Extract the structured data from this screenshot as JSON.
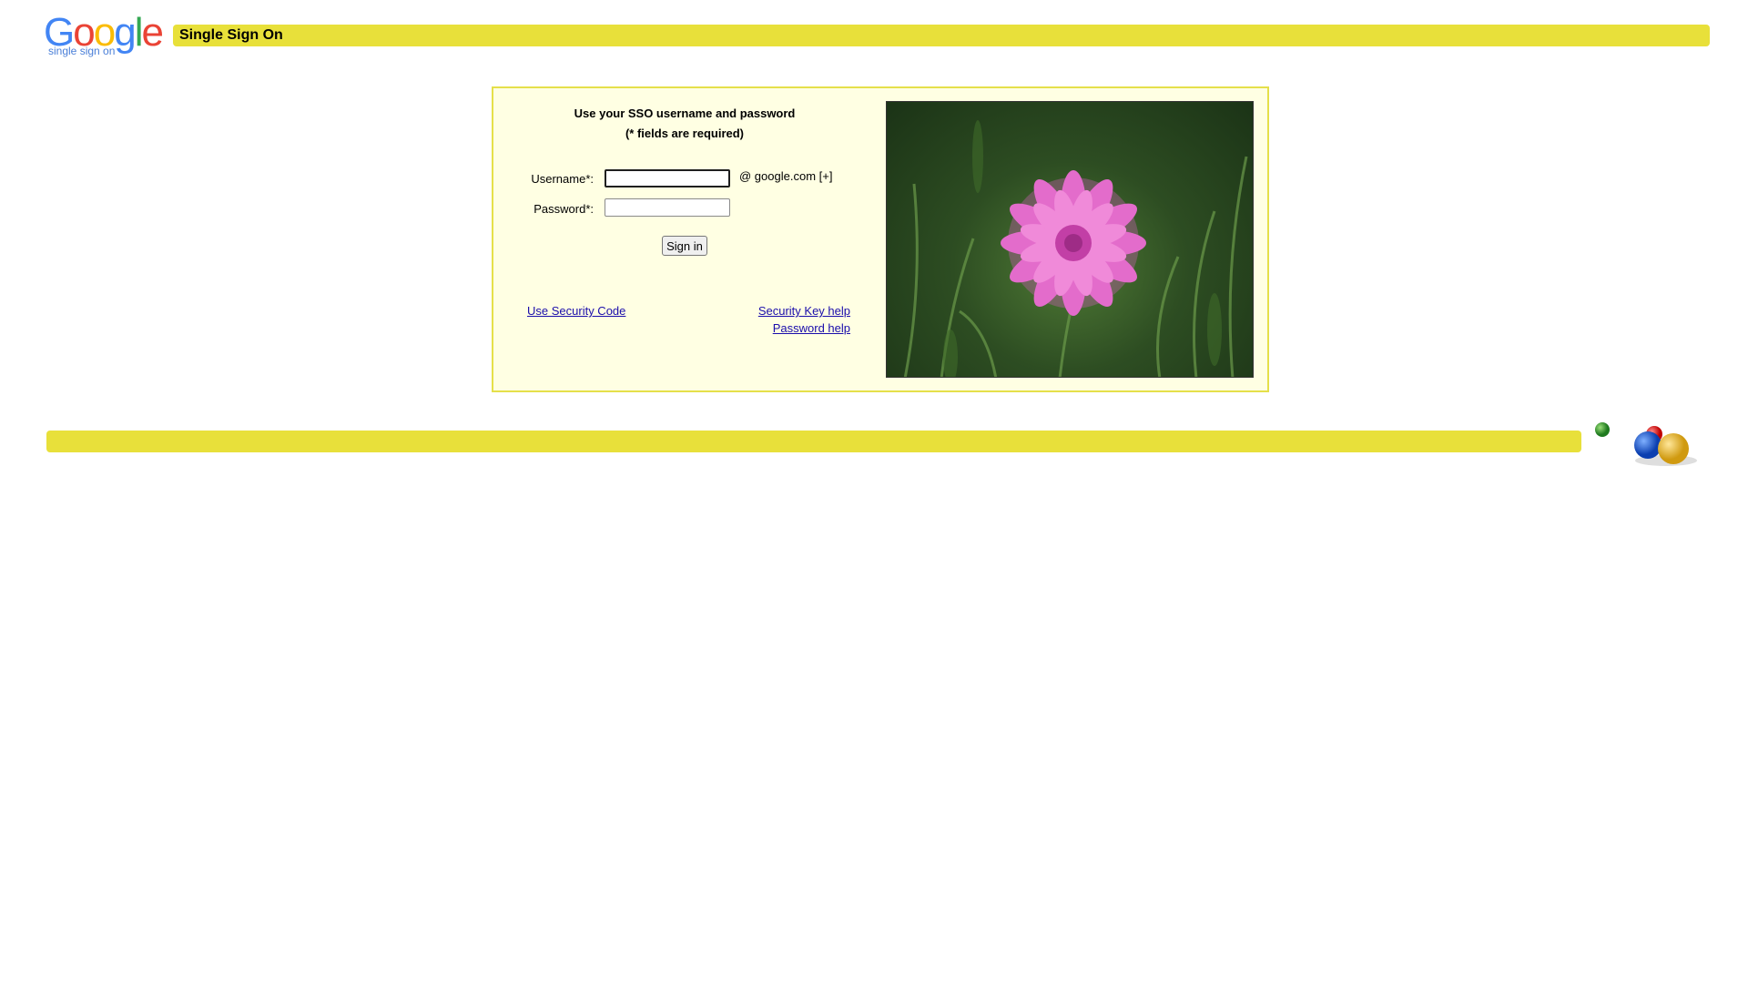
{
  "header": {
    "logo_text": "Google",
    "logo_subtitle": "single sign on",
    "title": "Single Sign On"
  },
  "login": {
    "heading": "Use your SSO username and password",
    "subheading": "(* fields are required)",
    "username_label": "Username*:",
    "username_value": "",
    "domain_suffix": "@  google.com [+]",
    "password_label": "Password*:",
    "password_value": "",
    "signin_label": "Sign in"
  },
  "links": {
    "security_code": "Use Security Code",
    "security_key_help": "Security Key help",
    "password_help": "Password help"
  },
  "colors": {
    "bar_yellow": "#e8e03a",
    "panel_bg": "#ffffe3",
    "link": "#1a0dab"
  },
  "icons": {
    "logo": "google-logo",
    "photo": "pink-cornflower-photo",
    "decoration": "colored-balls-icon"
  }
}
